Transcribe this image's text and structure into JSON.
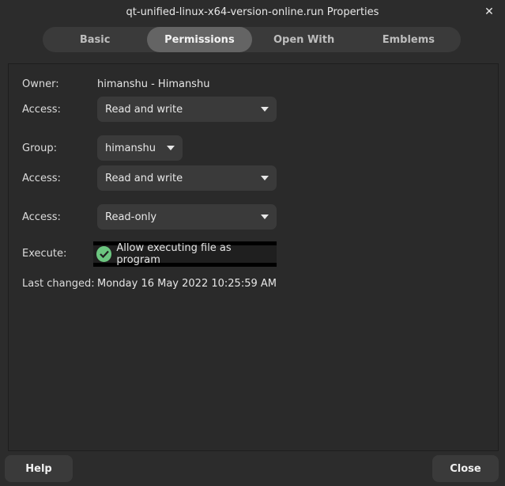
{
  "window": {
    "title": "qt-unified-linux-x64-version-online.run Properties"
  },
  "tabs": [
    {
      "label": "Basic"
    },
    {
      "label": "Permissions"
    },
    {
      "label": "Open With"
    },
    {
      "label": "Emblems"
    }
  ],
  "active_tab": "Permissions",
  "permissions": {
    "owner_label": "Owner:",
    "owner_value": "himanshu - Himanshu",
    "owner_access_label": "Access:",
    "owner_access_value": "Read and write",
    "group_label": "Group:",
    "group_value": "himanshu",
    "group_access_label": "Access:",
    "group_access_value": "Read and write",
    "other_access_label": "Access:",
    "other_access_value": "Read-only",
    "execute_label": "Execute:",
    "execute_checkbox_label": "Allow executing file as program",
    "execute_checked": true,
    "last_changed_label": "Last changed:",
    "last_changed_value": "Monday 16 May 2022 10:25:59 AM"
  },
  "footer": {
    "help_label": "Help",
    "close_label": "Close"
  },
  "colors": {
    "accent_check": "#6cc680",
    "background": "#2c2c2c",
    "active_tab": "#646464"
  }
}
